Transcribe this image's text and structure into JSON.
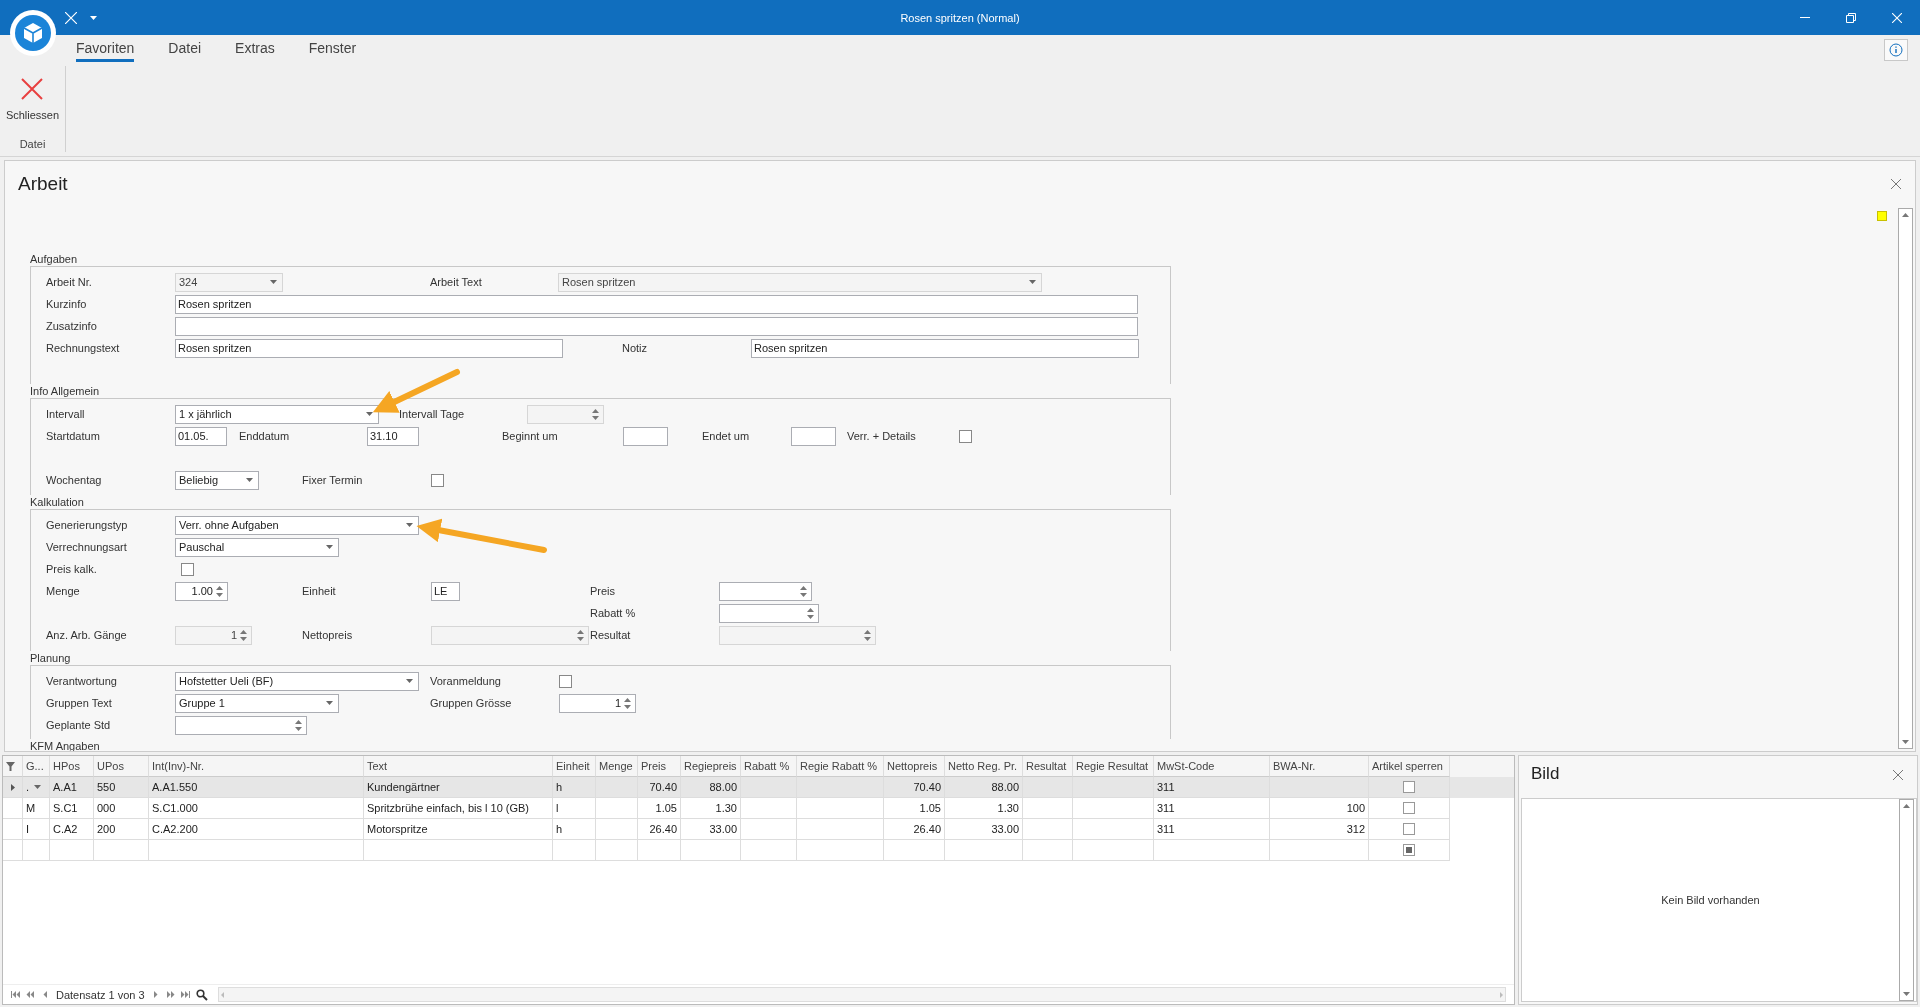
{
  "window": {
    "title": "Rosen spritzen (Normal)"
  },
  "menu_tabs": [
    {
      "label": "Favoriten",
      "selected": true
    },
    {
      "label": "Datei",
      "selected": false
    },
    {
      "label": "Extras",
      "selected": false
    },
    {
      "label": "Fenster",
      "selected": false
    }
  ],
  "ribbon": {
    "buttons": [
      {
        "label": "Schliessen"
      }
    ],
    "group_label": "Datei"
  },
  "form": {
    "title": "Arbeit",
    "sections": [
      {
        "title": "Aufgaben",
        "rows": [
          [
            {
              "kind": "label",
              "text": "Arbeit Nr."
            },
            {
              "kind": "combo",
              "value": "324",
              "disabled": true
            },
            {
              "kind": "label",
              "text": "Arbeit Text"
            },
            {
              "kind": "combo",
              "value": "Rosen spritzen",
              "disabled": true
            }
          ],
          [
            {
              "kind": "label",
              "text": "Kurzinfo"
            },
            {
              "kind": "text",
              "value": "Rosen spritzen",
              "disabled": false
            }
          ],
          [
            {
              "kind": "label",
              "text": "Zusatzinfo"
            },
            {
              "kind": "text",
              "disabled": false
            }
          ],
          [
            {
              "kind": "label",
              "text": "Rechnungstext"
            },
            {
              "kind": "text",
              "value": "Rosen spritzen",
              "disabled": false
            },
            {
              "kind": "label",
              "text": "Notiz"
            },
            {
              "kind": "text",
              "value": "Rosen spritzen",
              "disabled": false
            }
          ]
        ]
      },
      {
        "title": "Info Allgemein",
        "rows": [
          [
            {
              "kind": "label",
              "text": "Intervall"
            },
            {
              "kind": "combo",
              "value": "1 x jährlich",
              "disabled": false
            },
            {
              "kind": "label",
              "text": "Intervall Tage"
            },
            {
              "kind": "spin",
              "disabled": true
            }
          ],
          [
            {
              "kind": "label",
              "text": "Startdatum"
            },
            {
              "kind": "text",
              "value": "01.05.",
              "disabled": false
            },
            {
              "kind": "label",
              "text": "Enddatum"
            },
            {
              "kind": "text",
              "value": "31.10",
              "disabled": false
            },
            {
              "kind": "label",
              "text": "Beginnt um"
            },
            {
              "kind": "text",
              "disabled": false
            },
            {
              "kind": "label",
              "text": "Endet um"
            },
            {
              "kind": "text",
              "disabled": false
            },
            {
              "kind": "label",
              "text": "Verr. + Details"
            },
            {
              "kind": "check",
              "checked": false
            }
          ],
          [
            {
              "kind": "label",
              "text": "Wochentag"
            },
            {
              "kind": "combo",
              "value": "Beliebig",
              "disabled": false
            },
            {
              "kind": "label",
              "text": "Fixer Termin"
            },
            {
              "kind": "check",
              "checked": false
            }
          ]
        ]
      },
      {
        "title": "Kalkulation",
        "rows": [
          [
            {
              "kind": "label",
              "text": "Generierungstyp"
            },
            {
              "kind": "combo",
              "value": "Verr. ohne Aufgaben",
              "disabled": false
            }
          ],
          [
            {
              "kind": "label",
              "text": "Verrechnungsart"
            },
            {
              "kind": "combo",
              "value": "Pauschal",
              "disabled": false
            }
          ],
          [
            {
              "kind": "label",
              "text": "Preis kalk."
            },
            {
              "kind": "check",
              "checked": false
            }
          ],
          [
            {
              "kind": "label",
              "text": "Menge"
            },
            {
              "kind": "spin",
              "value": "1.00",
              "disabled": false
            },
            {
              "kind": "label",
              "text": "Einheit"
            },
            {
              "kind": "text",
              "value": "LE",
              "disabled": false
            },
            {
              "kind": "label",
              "text": "Preis"
            },
            {
              "kind": "spin",
              "disabled": false
            }
          ],
          [
            "",
            "",
            "",
            "",
            {
              "kind": "label",
              "text": "Rabatt %"
            },
            {
              "kind": "spin",
              "disabled": false
            }
          ],
          [
            {
              "kind": "label",
              "text": "Anz. Arb. Gänge"
            },
            {
              "kind": "spin",
              "value": "1",
              "disabled": true
            },
            {
              "kind": "label",
              "text": "Nettopreis"
            },
            {
              "kind": "spin",
              "disabled": true
            },
            {
              "kind": "label",
              "text": "Resultat"
            },
            {
              "kind": "spin",
              "disabled": true
            }
          ]
        ]
      },
      {
        "title": "Planung",
        "rows": [
          [
            {
              "kind": "label",
              "text": "Verantwortung"
            },
            {
              "kind": "combo",
              "value": "Hofstetter Ueli (BF)",
              "disabled": false
            },
            {
              "kind": "label",
              "text": "Voranmeldung"
            },
            {
              "kind": "check",
              "checked": false
            }
          ],
          [
            {
              "kind": "label",
              "text": "Gruppen Text"
            },
            {
              "kind": "combo",
              "value": "Gruppe 1",
              "disabled": false
            },
            {
              "kind": "label",
              "text": "Gruppen Grösse"
            },
            {
              "kind": "spin",
              "value": "1",
              "disabled": false
            }
          ],
          [
            {
              "kind": "label",
              "text": "Geplante Std"
            },
            {
              "kind": "spin",
              "disabled": false
            }
          ]
        ]
      },
      {
        "title": "KFM Angaben"
      }
    ]
  },
  "annotations": [
    {
      "kind": "arrow"
    },
    {
      "kind": "arrow"
    }
  ],
  "grid": {
    "columns": [
      {
        "label": "G..."
      },
      {
        "label": "HPos"
      },
      {
        "label": "UPos"
      },
      {
        "label": "Int(Inv)-Nr."
      },
      {
        "label": "Text"
      },
      {
        "label": "Einheit"
      },
      {
        "label": "Menge"
      },
      {
        "label": "Preis"
      },
      {
        "label": "Regiepreis"
      },
      {
        "label": "Rabatt %"
      },
      {
        "label": "Regie Rabatt %"
      },
      {
        "label": "Nettopreis"
      },
      {
        "label": "Netto Reg. Pr."
      },
      {
        "label": "Resultat"
      },
      {
        "label": "Regie Resultat"
      },
      {
        "label": "MwSt-Code"
      },
      {
        "label": "BWA-Nr."
      },
      {
        "label": "Artikel sperren"
      }
    ],
    "rows": [
      {
        "kind": "data",
        "selected": true,
        "cells": [
          ".",
          "A.A1",
          "550",
          "A.A1.550",
          "Kundengärtner",
          "h",
          null,
          "70.40",
          "88.00",
          null,
          null,
          "70.40",
          "88.00",
          null,
          null,
          "311",
          null
        ],
        "checked": false,
        "indeterminate": false
      },
      {
        "kind": "data",
        "selected": false,
        "cells": [
          "M",
          "S.C1",
          "000",
          "S.C1.000",
          "Spritzbrühe einfach, bis l 10 (GB)",
          "l",
          null,
          "1.05",
          "1.30",
          null,
          null,
          "1.05",
          "1.30",
          null,
          null,
          "311",
          "100"
        ],
        "checked": false,
        "indeterminate": false
      },
      {
        "kind": "data",
        "selected": false,
        "cells": [
          "I",
          "C.A2",
          "200",
          "C.A2.200",
          "Motorspritze",
          "h",
          null,
          "26.40",
          "33.00",
          null,
          null,
          "26.40",
          "33.00",
          null,
          null,
          "311",
          "312"
        ],
        "checked": false,
        "indeterminate": false
      },
      {
        "kind": "new_row",
        "selected": false,
        "indeterminate": true
      }
    ],
    "record_info": "Datensatz 1 von 3"
  },
  "picture_panel": {
    "title": "Bild",
    "empty_text": "Kein Bild vorhanden"
  }
}
